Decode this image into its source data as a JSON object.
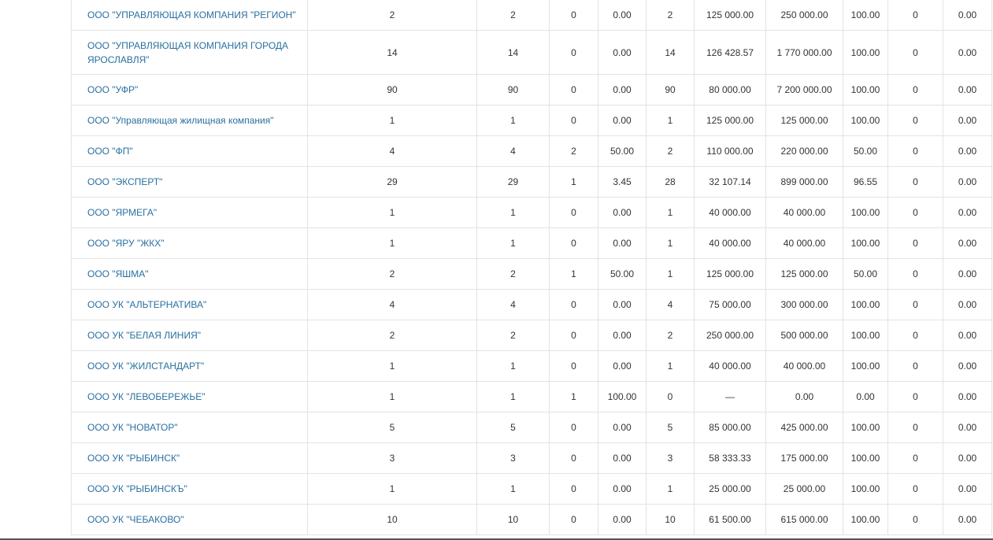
{
  "table": {
    "rows": [
      {
        "name": "ООО \"УПРАВЛЯЮЩАЯ КОМПАНИЯ \"РЕГИОН\"",
        "c1": "2",
        "c2": "2",
        "c3": "0",
        "c4": "0.00",
        "c5": "2",
        "c6": "125 000.00",
        "c7": "250 000.00",
        "c8": "100.00",
        "c9": "0",
        "c10": "0.00"
      },
      {
        "name": "ООО \"УПРАВЛЯЮЩАЯ КОМПАНИЯ ГОРОДА ЯРОСЛАВЛЯ\"",
        "c1": "14",
        "c2": "14",
        "c3": "0",
        "c4": "0.00",
        "c5": "14",
        "c6": "126 428.57",
        "c7": "1 770 000.00",
        "c8": "100.00",
        "c9": "0",
        "c10": "0.00"
      },
      {
        "name": "ООО \"УФР\"",
        "c1": "90",
        "c2": "90",
        "c3": "0",
        "c4": "0.00",
        "c5": "90",
        "c6": "80 000.00",
        "c7": "7 200 000.00",
        "c8": "100.00",
        "c9": "0",
        "c10": "0.00"
      },
      {
        "name": "ООО \"Управляющая жилищная компания\"",
        "c1": "1",
        "c2": "1",
        "c3": "0",
        "c4": "0.00",
        "c5": "1",
        "c6": "125 000.00",
        "c7": "125 000.00",
        "c8": "100.00",
        "c9": "0",
        "c10": "0.00"
      },
      {
        "name": "ООО \"ФП\"",
        "c1": "4",
        "c2": "4",
        "c3": "2",
        "c4": "50.00",
        "c5": "2",
        "c6": "110 000.00",
        "c7": "220 000.00",
        "c8": "50.00",
        "c9": "0",
        "c10": "0.00"
      },
      {
        "name": "ООО \"ЭКСПЕРТ\"",
        "c1": "29",
        "c2": "29",
        "c3": "1",
        "c4": "3.45",
        "c5": "28",
        "c6": "32 107.14",
        "c7": "899 000.00",
        "c8": "96.55",
        "c9": "0",
        "c10": "0.00"
      },
      {
        "name": "ООО \"ЯРМЕГА\"",
        "c1": "1",
        "c2": "1",
        "c3": "0",
        "c4": "0.00",
        "c5": "1",
        "c6": "40 000.00",
        "c7": "40 000.00",
        "c8": "100.00",
        "c9": "0",
        "c10": "0.00"
      },
      {
        "name": "ООО \"ЯРУ \"ЖКХ\"",
        "c1": "1",
        "c2": "1",
        "c3": "0",
        "c4": "0.00",
        "c5": "1",
        "c6": "40 000.00",
        "c7": "40 000.00",
        "c8": "100.00",
        "c9": "0",
        "c10": "0.00"
      },
      {
        "name": "ООО \"ЯШМА\"",
        "c1": "2",
        "c2": "2",
        "c3": "1",
        "c4": "50.00",
        "c5": "1",
        "c6": "125 000.00",
        "c7": "125 000.00",
        "c8": "50.00",
        "c9": "0",
        "c10": "0.00"
      },
      {
        "name": "ООО УК \"АЛЬТЕРНАТИВА\"",
        "c1": "4",
        "c2": "4",
        "c3": "0",
        "c4": "0.00",
        "c5": "4",
        "c6": "75 000.00",
        "c7": "300 000.00",
        "c8": "100.00",
        "c9": "0",
        "c10": "0.00"
      },
      {
        "name": "ООО УК \"БЕЛАЯ ЛИНИЯ\"",
        "c1": "2",
        "c2": "2",
        "c3": "0",
        "c4": "0.00",
        "c5": "2",
        "c6": "250 000.00",
        "c7": "500 000.00",
        "c8": "100.00",
        "c9": "0",
        "c10": "0.00"
      },
      {
        "name": "ООО УК \"ЖИЛСТАНДАРТ\"",
        "c1": "1",
        "c2": "1",
        "c3": "0",
        "c4": "0.00",
        "c5": "1",
        "c6": "40 000.00",
        "c7": "40 000.00",
        "c8": "100.00",
        "c9": "0",
        "c10": "0.00"
      },
      {
        "name": "ООО УК \"ЛЕВОБЕРЕЖЬЕ\"",
        "c1": "1",
        "c2": "1",
        "c3": "1",
        "c4": "100.00",
        "c5": "0",
        "c6": "—",
        "c7": "0.00",
        "c8": "0.00",
        "c9": "0",
        "c10": "0.00"
      },
      {
        "name": "ООО УК \"НОВАТОР\"",
        "c1": "5",
        "c2": "5",
        "c3": "0",
        "c4": "0.00",
        "c5": "5",
        "c6": "85 000.00",
        "c7": "425 000.00",
        "c8": "100.00",
        "c9": "0",
        "c10": "0.00"
      },
      {
        "name": "ООО УК \"РЫБИНСК\"",
        "c1": "3",
        "c2": "3",
        "c3": "0",
        "c4": "0.00",
        "c5": "3",
        "c6": "58 333.33",
        "c7": "175 000.00",
        "c8": "100.00",
        "c9": "0",
        "c10": "0.00"
      },
      {
        "name": "ООО УК \"РЫБИНСКЪ\"",
        "c1": "1",
        "c2": "1",
        "c3": "0",
        "c4": "0.00",
        "c5": "1",
        "c6": "25 000.00",
        "c7": "25 000.00",
        "c8": "100.00",
        "c9": "0",
        "c10": "0.00"
      },
      {
        "name": "ООО УК \"ЧЕБАКОВО\"",
        "c1": "10",
        "c2": "10",
        "c3": "0",
        "c4": "0.00",
        "c5": "10",
        "c6": "61 500.00",
        "c7": "615 000.00",
        "c8": "100.00",
        "c9": "0",
        "c10": "0.00"
      }
    ]
  }
}
